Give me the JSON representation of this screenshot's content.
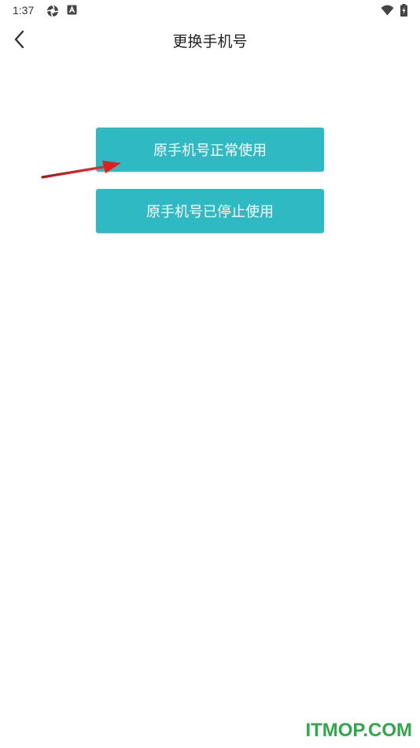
{
  "status_bar": {
    "time": "1:37",
    "icons": [
      "aperture-icon",
      "a-badge-icon",
      "wifi-icon",
      "battery-charging-icon"
    ]
  },
  "header": {
    "back_icon": "chevron-left-icon",
    "title": "更换手机号"
  },
  "options": [
    {
      "label": "原手机号正常使用"
    },
    {
      "label": "原手机号已停止使用"
    }
  ],
  "colors": {
    "button_bg": "#2fbac3",
    "button_text": "#ffffff",
    "arrow": "#e02020",
    "watermark": "#2fa84b"
  },
  "watermark": "ITMOP.COM"
}
